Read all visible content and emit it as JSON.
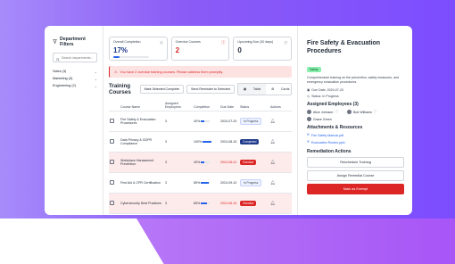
{
  "filters": {
    "title": "Department Filters",
    "search_placeholder": "Search departments...",
    "groups": [
      {
        "label": "Sales (3)"
      },
      {
        "label": "Marketing (3)"
      },
      {
        "label": "Engineering (2)"
      }
    ]
  },
  "stats": [
    {
      "label": "Overall Completion",
      "value": "17%",
      "progress": 0.17
    },
    {
      "label": "Overdue Courses",
      "value": "2"
    },
    {
      "label": "Upcoming Due (30 days)",
      "value": "0"
    }
  ],
  "alert": "You have 2 overdue training courses. Please address them promptly.",
  "training": {
    "title": "Training Courses",
    "mark_selected": "Mark Selected Complete",
    "send_reminder": "Send Reminder to Selected",
    "view_table": "Table",
    "view_cards": "Cards",
    "columns": [
      "Course Name",
      "Assigned Employees",
      "Completion",
      "Due Date",
      "Status",
      "Actions"
    ],
    "rows": [
      {
        "name": "Fire Safety & Evacuation Procedures",
        "assigned": "3",
        "completion": "40%",
        "pct": 0.4,
        "due": "2024-07-20",
        "status": "In Progress",
        "overdue": false
      },
      {
        "name": "Data Privacy & GDPR Compliance",
        "assigned": "3",
        "completion": "100%",
        "pct": 1.0,
        "due": "2024-08-15",
        "status": "Completed",
        "overdue": false
      },
      {
        "name": "Workplace Harassment Prevention",
        "assigned": "3",
        "completion": "40%",
        "pct": 0.4,
        "due": "2024-06-01",
        "status": "Overdue",
        "overdue": true
      },
      {
        "name": "First Aid & CPR Certification",
        "assigned": "3",
        "completion": "85%",
        "pct": 0.85,
        "due": "2024-09-10",
        "status": "In Progress",
        "overdue": false
      },
      {
        "name": "Cybersecurity Best Practices",
        "assigned": "3",
        "completion": "65%",
        "pct": 0.65,
        "due": "2024-06-15",
        "status": "Overdue",
        "overdue": true
      }
    ]
  },
  "detail": {
    "title": "Fire Safety & Evacuation Procedures",
    "badge": "Safety",
    "description": "Comprehensive training on fire prevention, safety measures, and emergency evacuation procedures.",
    "due": "Due Date: 2024-07-20",
    "status": "Status: In Progress",
    "employees_title": "Assigned Employees (3)",
    "employees": [
      {
        "name": "Alice Johnson"
      },
      {
        "name": "Bob Williams"
      },
      {
        "name": "Grace Green"
      }
    ],
    "attachments_title": "Attachments & Resources",
    "attachments": [
      {
        "name": "Fire Safety Manual.pdf"
      },
      {
        "name": "Evacuation Routes.pptx"
      }
    ],
    "remediation_title": "Remediation Actions",
    "reschedule": "Reschedule Training",
    "assign_remedial": "Assign Remedial Course",
    "mark_exempt": "Mark as Exempt"
  },
  "colors": {
    "accent": "#2563eb",
    "danger": "#dc2626",
    "success_badge": "#86efac"
  }
}
